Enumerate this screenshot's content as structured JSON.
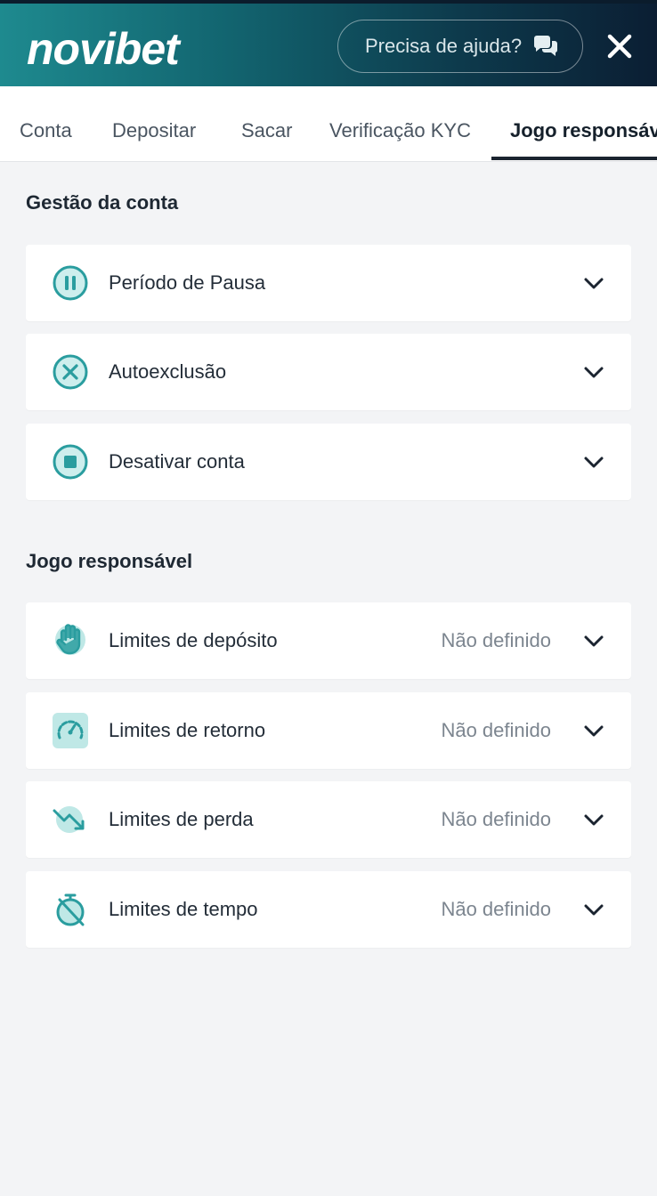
{
  "header": {
    "logo": "novibet",
    "help_label": "Precisa de ajuda?"
  },
  "tabs": [
    {
      "label": "Conta"
    },
    {
      "label": "Depositar"
    },
    {
      "label": "Sacar"
    },
    {
      "label": "Verificação KYC"
    },
    {
      "label": "Jogo responsável",
      "active": true
    }
  ],
  "account_section": {
    "title": "Gestão da conta",
    "items": [
      {
        "label": "Período de Pausa",
        "icon": "pause-circle-icon"
      },
      {
        "label": "Autoexclusão",
        "icon": "x-circle-icon"
      },
      {
        "label": "Desativar conta",
        "icon": "stop-circle-icon"
      }
    ]
  },
  "responsible_section": {
    "title": "Jogo responsável",
    "items": [
      {
        "label": "Limites de depósito",
        "status": "Não definido",
        "icon": "hand-icon"
      },
      {
        "label": "Limites de retorno",
        "status": "Não definido",
        "icon": "gauge-icon"
      },
      {
        "label": "Limites de perda",
        "status": "Não definido",
        "icon": "trending-down-icon"
      },
      {
        "label": "Limites de tempo",
        "status": "Não definido",
        "icon": "timer-off-icon"
      }
    ]
  },
  "colors": {
    "accent": "#2a9d9f",
    "icon_fill": "#bfe8e6",
    "page_bg": "#f3f4f6"
  }
}
